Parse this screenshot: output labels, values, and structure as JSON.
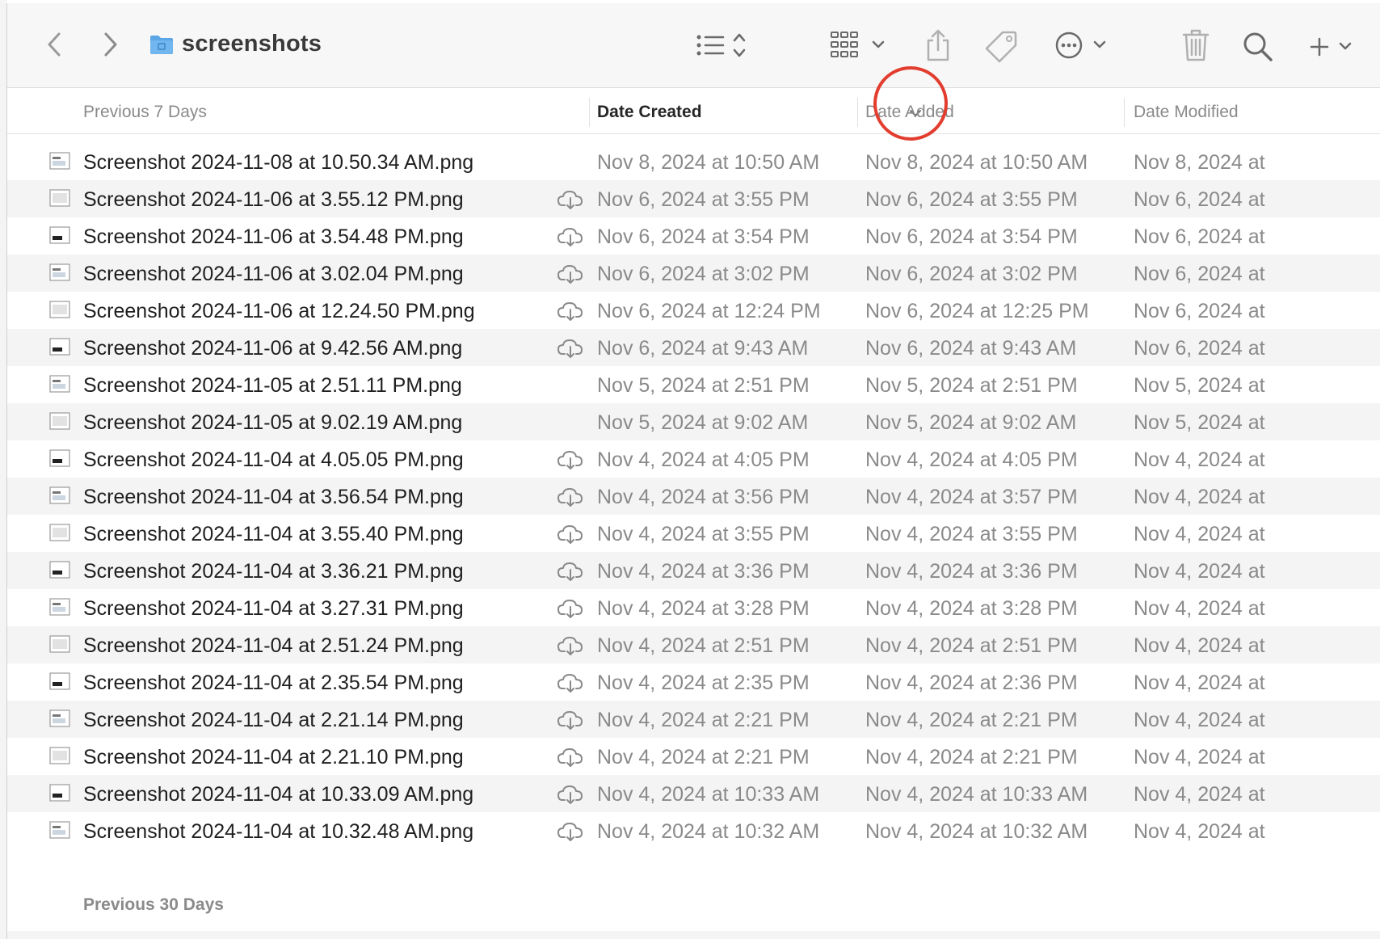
{
  "window": {
    "title": "screenshots"
  },
  "icons": {
    "back": "chevron-left-icon",
    "forward": "chevron-right-icon",
    "folder": "folder-icon",
    "list_view": "list-view-icon",
    "group": "grid-group-icon",
    "share": "share-icon",
    "tag": "tag-icon",
    "more": "ellipsis-circle-icon",
    "trash": "trash-icon",
    "search": "search-icon",
    "add": "plus-icon",
    "cloud": "cloud-download-icon",
    "sort": "chevron-down-icon"
  },
  "header": {
    "group_label": "Previous 7 Days",
    "col_created": "Date Created",
    "col_added": "Date Added",
    "col_modified": "Date Modified"
  },
  "annotation_color": "#e23d2e",
  "files": [
    {
      "name": "Screenshot 2024-11-08 at 10.50.34 AM.png",
      "cloud": false,
      "created": "Nov 8, 2024 at 10:50 AM",
      "added": "Nov 8, 2024 at 10:50 AM",
      "modified": "Nov 8, 2024 at"
    },
    {
      "name": "Screenshot 2024-11-06 at 3.55.12 PM.png",
      "cloud": true,
      "created": "Nov 6, 2024 at 3:55 PM",
      "added": "Nov 6, 2024 at 3:55 PM",
      "modified": "Nov 6, 2024 at"
    },
    {
      "name": "Screenshot 2024-11-06 at 3.54.48 PM.png",
      "cloud": true,
      "created": "Nov 6, 2024 at 3:54 PM",
      "added": "Nov 6, 2024 at 3:54 PM",
      "modified": "Nov 6, 2024 at"
    },
    {
      "name": "Screenshot 2024-11-06 at 3.02.04 PM.png",
      "cloud": true,
      "created": "Nov 6, 2024 at 3:02 PM",
      "added": "Nov 6, 2024 at 3:02 PM",
      "modified": "Nov 6, 2024 at"
    },
    {
      "name": "Screenshot 2024-11-06 at 12.24.50 PM.png",
      "cloud": true,
      "created": "Nov 6, 2024 at 12:24 PM",
      "added": "Nov 6, 2024 at 12:25 PM",
      "modified": "Nov 6, 2024 at"
    },
    {
      "name": "Screenshot 2024-11-06 at 9.42.56 AM.png",
      "cloud": true,
      "created": "Nov 6, 2024 at 9:43 AM",
      "added": "Nov 6, 2024 at 9:43 AM",
      "modified": "Nov 6, 2024 at"
    },
    {
      "name": "Screenshot 2024-11-05 at 2.51.11 PM.png",
      "cloud": false,
      "created": "Nov 5, 2024 at 2:51 PM",
      "added": "Nov 5, 2024 at 2:51 PM",
      "modified": "Nov 5, 2024 at"
    },
    {
      "name": "Screenshot 2024-11-05 at 9.02.19 AM.png",
      "cloud": false,
      "created": "Nov 5, 2024 at 9:02 AM",
      "added": "Nov 5, 2024 at 9:02 AM",
      "modified": "Nov 5, 2024 at"
    },
    {
      "name": "Screenshot 2024-11-04 at 4.05.05 PM.png",
      "cloud": true,
      "created": "Nov 4, 2024 at 4:05 PM",
      "added": "Nov 4, 2024 at 4:05 PM",
      "modified": "Nov 4, 2024 at"
    },
    {
      "name": "Screenshot 2024-11-04 at 3.56.54 PM.png",
      "cloud": true,
      "created": "Nov 4, 2024 at 3:56 PM",
      "added": "Nov 4, 2024 at 3:57 PM",
      "modified": "Nov 4, 2024 at"
    },
    {
      "name": "Screenshot 2024-11-04 at 3.55.40 PM.png",
      "cloud": true,
      "created": "Nov 4, 2024 at 3:55 PM",
      "added": "Nov 4, 2024 at 3:55 PM",
      "modified": "Nov 4, 2024 at"
    },
    {
      "name": "Screenshot 2024-11-04 at 3.36.21 PM.png",
      "cloud": true,
      "created": "Nov 4, 2024 at 3:36 PM",
      "added": "Nov 4, 2024 at 3:36 PM",
      "modified": "Nov 4, 2024 at"
    },
    {
      "name": "Screenshot 2024-11-04 at 3.27.31 PM.png",
      "cloud": true,
      "created": "Nov 4, 2024 at 3:28 PM",
      "added": "Nov 4, 2024 at 3:28 PM",
      "modified": "Nov 4, 2024 at"
    },
    {
      "name": "Screenshot 2024-11-04 at 2.51.24 PM.png",
      "cloud": true,
      "created": "Nov 4, 2024 at 2:51 PM",
      "added": "Nov 4, 2024 at 2:51 PM",
      "modified": "Nov 4, 2024 at"
    },
    {
      "name": "Screenshot 2024-11-04 at 2.35.54 PM.png",
      "cloud": true,
      "created": "Nov 4, 2024 at 2:35 PM",
      "added": "Nov 4, 2024 at 2:36 PM",
      "modified": "Nov 4, 2024 at"
    },
    {
      "name": "Screenshot 2024-11-04 at 2.21.14 PM.png",
      "cloud": true,
      "created": "Nov 4, 2024 at 2:21 PM",
      "added": "Nov 4, 2024 at 2:21 PM",
      "modified": "Nov 4, 2024 at"
    },
    {
      "name": "Screenshot 2024-11-04 at 2.21.10 PM.png",
      "cloud": true,
      "created": "Nov 4, 2024 at 2:21 PM",
      "added": "Nov 4, 2024 at 2:21 PM",
      "modified": "Nov 4, 2024 at"
    },
    {
      "name": "Screenshot 2024-11-04 at 10.33.09 AM.png",
      "cloud": true,
      "created": "Nov 4, 2024 at 10:33 AM",
      "added": "Nov 4, 2024 at 10:33 AM",
      "modified": "Nov 4, 2024 at"
    },
    {
      "name": "Screenshot 2024-11-04 at 10.32.48 AM.png",
      "cloud": true,
      "created": "Nov 4, 2024 at 10:32 AM",
      "added": "Nov 4, 2024 at 10:32 AM",
      "modified": "Nov 4, 2024 at"
    }
  ],
  "group2_label": "Previous 30 Days"
}
